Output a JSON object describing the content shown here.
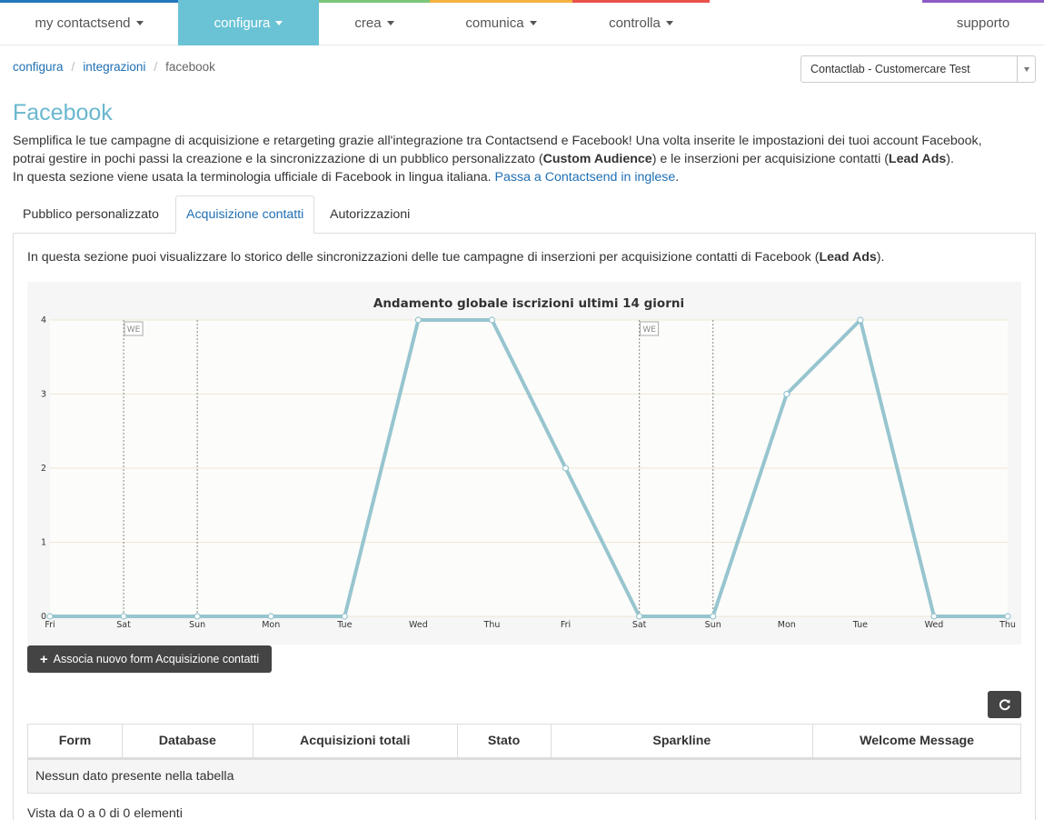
{
  "nav": {
    "items": [
      {
        "label": "my contactsend",
        "color": "#2278bd"
      },
      {
        "label": "configura",
        "color": "#6ac3d5"
      },
      {
        "label": "crea",
        "color": "#7cc67a"
      },
      {
        "label": "comunica",
        "color": "#f4b33f"
      },
      {
        "label": "controlla",
        "color": "#e9524b"
      }
    ],
    "support": {
      "label": "supporto",
      "color": "#8d5cc7"
    }
  },
  "breadcrumb": {
    "items": [
      "configura",
      "integrazioni"
    ],
    "current": "facebook"
  },
  "account_select": {
    "value": "Contactlab - Customercare Test"
  },
  "page": {
    "title": "Facebook",
    "intro_line1": "Semplifica le tue campagne di acquisizione e retargeting grazie all'integrazione tra Contactsend e Facebook! Una volta inserite le impostazioni dei tuoi account Facebook,",
    "intro_line2_pre": "potrai gestire in pochi passi la creazione e la sincronizzazione di un pubblico personalizzato (",
    "intro_line2_b1": "Custom Audience",
    "intro_line2_mid": ") e le inserzioni per acquisizione contatti (",
    "intro_line2_b2": "Lead Ads",
    "intro_line2_post": ").",
    "intro_line3_pre": "In questa sezione viene usata la terminologia ufficiale di Facebook in lingua italiana.",
    "intro_line3_link": "Passa a Contactsend in inglese",
    "intro_line3_post": "."
  },
  "tabs": [
    "Pubblico personalizzato",
    "Acquisizione contatti",
    "Autorizzazioni"
  ],
  "active_tab": "Acquisizione contatti",
  "panel": {
    "desc_pre": "In questa sezione puoi visualizzare lo storico delle sincronizzazioni delle tue campagne di inserzioni per acquisizione contatti di Facebook (",
    "desc_bold": "Lead Ads",
    "desc_post": ")."
  },
  "chart_data": {
    "type": "line",
    "title": "Andamento globale iscrizioni ultimi 14 giorni",
    "x": [
      "Fri",
      "Sat",
      "Sun",
      "Mon",
      "Tue",
      "Wed",
      "Thu",
      "Fri",
      "Sat",
      "Sun",
      "Mon",
      "Tue",
      "Wed",
      "Thu"
    ],
    "values": [
      0,
      0,
      0,
      0,
      0,
      4,
      4,
      2,
      0,
      0,
      3,
      4,
      0,
      0
    ],
    "ylim": [
      0,
      4
    ],
    "yticks": [
      0,
      1,
      2,
      3,
      4
    ],
    "weekend_label": "WE",
    "weekend_markers_at": [
      1,
      8
    ],
    "line_color": "#97c5cf",
    "grid": true
  },
  "buttons": {
    "add_form": "Associa nuovo form Acquisizione contatti"
  },
  "table": {
    "columns": [
      "Form",
      "Database",
      "Acquisizioni totali",
      "Stato",
      "Sparkline",
      "Welcome Message"
    ],
    "empty_text": "Nessun dato presente nella tabella",
    "info": "Vista da 0 a 0 di 0 elementi"
  }
}
